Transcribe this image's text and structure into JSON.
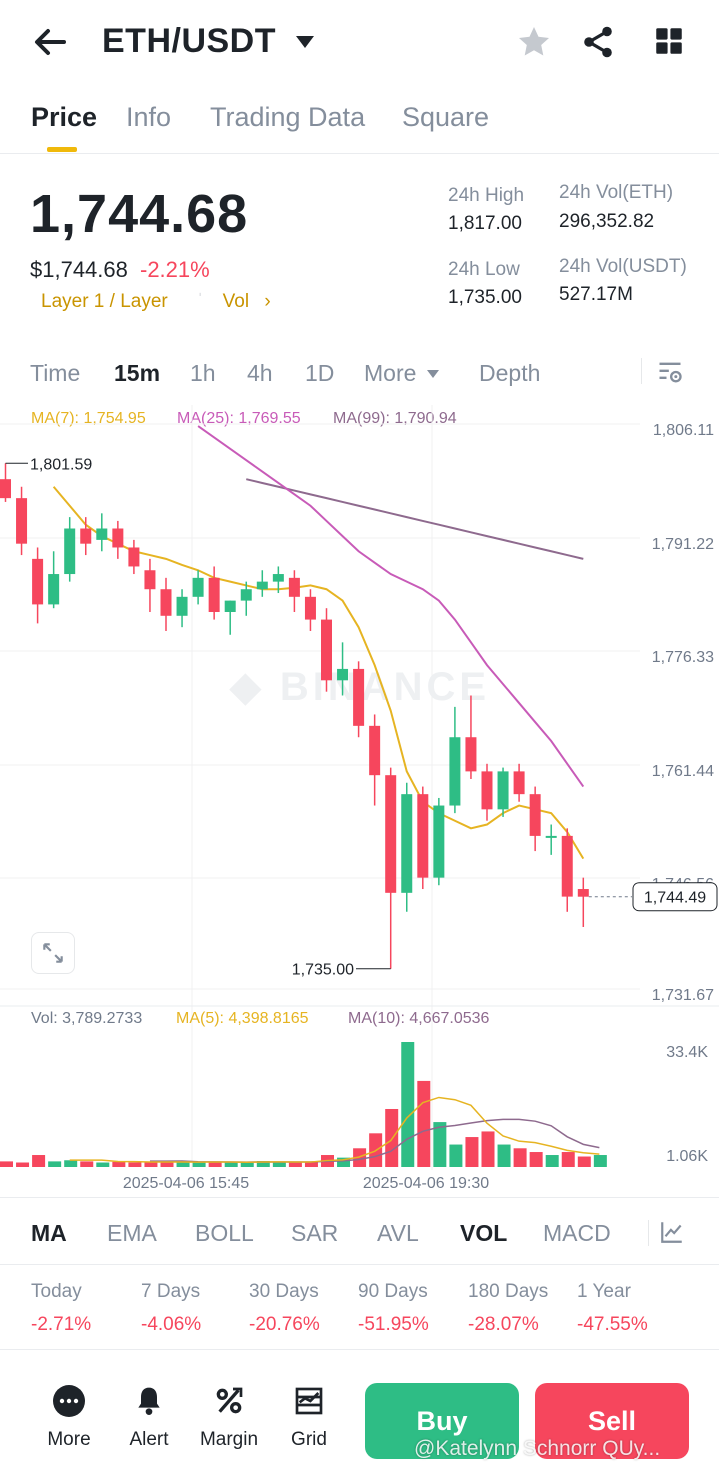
{
  "header": {
    "pair": "ETH/USDT"
  },
  "tabs": [
    "Price",
    "Info",
    "Trading Data",
    "Square"
  ],
  "price": {
    "last": "1,744.68",
    "usd": "$1,744.68",
    "change": "-2.21%",
    "tags": "Layer 1 / Layer",
    "vol_link": "Vol",
    "high_label": "24h High",
    "high": "1,817.00",
    "low_label": "24h Low",
    "low": "1,735.00",
    "vol_eth_label": "24h Vol(ETH)",
    "vol_eth": "296,352.82",
    "vol_usdt_label": "24h Vol(USDT)",
    "vol_usdt": "527.17M"
  },
  "timeframes": [
    "Time",
    "15m",
    "1h",
    "4h",
    "1D",
    "More",
    "Depth"
  ],
  "ma": {
    "ma7": "MA(7): 1,754.95",
    "ma25": "MA(25): 1,769.55",
    "ma99": "MA(99): 1,790.94"
  },
  "colors": {
    "up": "#2ebd85",
    "down": "#f6465d",
    "ma7": "#e6b422",
    "ma25": "#c85bb8",
    "ma99": "#8e6a8e",
    "brand": "#f0b90b"
  },
  "chart_data": {
    "type": "candlestick",
    "watermark": "BINANCE",
    "y_ticks": [
      "1,806.11",
      "1,791.22",
      "1,776.33",
      "1,761.44",
      "1,746.56",
      "1,731.67"
    ],
    "ylim": [
      1731.67,
      1806.11
    ],
    "last_price_label": "1,744.49",
    "high_marker": "1,801.59",
    "low_marker": "1,735.00",
    "x_labels": [
      "2025-04-06 15:45",
      "2025-04-06 19:30"
    ],
    "candles": [
      {
        "o": 1799.5,
        "h": 1801.59,
        "l": 1796.5,
        "c": 1797.0
      },
      {
        "o": 1797.0,
        "h": 1798.5,
        "l": 1789.5,
        "c": 1791.0
      },
      {
        "o": 1789.0,
        "h": 1790.5,
        "l": 1780.5,
        "c": 1783.0
      },
      {
        "o": 1783.0,
        "h": 1790.0,
        "l": 1782.5,
        "c": 1787.0
      },
      {
        "o": 1787.0,
        "h": 1794.5,
        "l": 1786.0,
        "c": 1793.0
      },
      {
        "o": 1793.0,
        "h": 1794.5,
        "l": 1789.5,
        "c": 1791.0
      },
      {
        "o": 1791.5,
        "h": 1795.0,
        "l": 1790.0,
        "c": 1793.0
      },
      {
        "o": 1793.0,
        "h": 1794.0,
        "l": 1789.0,
        "c": 1790.5
      },
      {
        "o": 1790.5,
        "h": 1791.5,
        "l": 1787.0,
        "c": 1788.0
      },
      {
        "o": 1787.5,
        "h": 1789.0,
        "l": 1782.0,
        "c": 1785.0
      },
      {
        "o": 1785.0,
        "h": 1786.5,
        "l": 1779.5,
        "c": 1781.5
      },
      {
        "o": 1781.5,
        "h": 1785.0,
        "l": 1780.0,
        "c": 1784.0
      },
      {
        "o": 1784.0,
        "h": 1787.5,
        "l": 1783.0,
        "c": 1786.5
      },
      {
        "o": 1786.5,
        "h": 1788.0,
        "l": 1781.0,
        "c": 1782.0
      },
      {
        "o": 1782.0,
        "h": 1783.5,
        "l": 1779.0,
        "c": 1783.5
      },
      {
        "o": 1783.5,
        "h": 1786.0,
        "l": 1781.5,
        "c": 1785.0
      },
      {
        "o": 1785.0,
        "h": 1787.5,
        "l": 1784.0,
        "c": 1786.0
      },
      {
        "o": 1786.0,
        "h": 1788.0,
        "l": 1784.5,
        "c": 1787.0
      },
      {
        "o": 1786.5,
        "h": 1787.5,
        "l": 1782.0,
        "c": 1784.0
      },
      {
        "o": 1784.0,
        "h": 1785.0,
        "l": 1779.5,
        "c": 1781.0
      },
      {
        "o": 1781.0,
        "h": 1782.5,
        "l": 1771.5,
        "c": 1773.0
      },
      {
        "o": 1773.0,
        "h": 1778.0,
        "l": 1771.0,
        "c": 1774.5
      },
      {
        "o": 1774.5,
        "h": 1775.5,
        "l": 1765.5,
        "c": 1767.0
      },
      {
        "o": 1767.0,
        "h": 1768.5,
        "l": 1756.5,
        "c": 1760.5
      },
      {
        "o": 1760.5,
        "h": 1761.5,
        "l": 1735.0,
        "c": 1745.0
      },
      {
        "o": 1745.0,
        "h": 1759.5,
        "l": 1742.5,
        "c": 1758.0
      },
      {
        "o": 1758.0,
        "h": 1759.0,
        "l": 1745.5,
        "c": 1747.0
      },
      {
        "o": 1747.0,
        "h": 1757.5,
        "l": 1746.0,
        "c": 1756.5
      },
      {
        "o": 1756.5,
        "h": 1769.5,
        "l": 1755.5,
        "c": 1765.5
      },
      {
        "o": 1765.5,
        "h": 1771.0,
        "l": 1760.0,
        "c": 1761.0
      },
      {
        "o": 1761.0,
        "h": 1762.0,
        "l": 1754.5,
        "c": 1756.0
      },
      {
        "o": 1756.0,
        "h": 1761.5,
        "l": 1755.0,
        "c": 1761.0
      },
      {
        "o": 1761.0,
        "h": 1762.0,
        "l": 1757.0,
        "c": 1758.0
      },
      {
        "o": 1758.0,
        "h": 1759.0,
        "l": 1750.5,
        "c": 1752.5
      },
      {
        "o": 1752.5,
        "h": 1754.0,
        "l": 1750.0,
        "c": 1752.5
      },
      {
        "o": 1752.5,
        "h": 1753.5,
        "l": 1742.5,
        "c": 1744.5
      },
      {
        "o": 1745.5,
        "h": 1747.0,
        "l": 1740.5,
        "c": 1744.49
      }
    ],
    "ma7_series": [
      1798.5,
      1796.0,
      1793.5,
      1792.0,
      1791.0,
      1790.0,
      1789.5,
      1789.0,
      1788.2,
      1787.5,
      1786.5,
      1786.0,
      1785.5,
      1785.0,
      1785.0,
      1785.2,
      1785.5,
      1785.0,
      1783.5,
      1780.0,
      1775.0,
      1769.0,
      1761.0,
      1757.0,
      1755.5,
      1754.5,
      1753.5,
      1754.0,
      1755.5,
      1756.5,
      1756.0,
      1755.5,
      1753.0,
      1749.5
    ],
    "ma25_series": [
      1806.5,
      1805.0,
      1803.5,
      1802.0,
      1800.5,
      1799.0,
      1797.5,
      1796.0,
      1794.0,
      1792.0,
      1790.0,
      1788.5,
      1787.0,
      1786.0,
      1785.0,
      1783.5,
      1781.0,
      1778.0,
      1775.0,
      1772.5,
      1770.0,
      1767.5,
      1765.0,
      1762.0,
      1759.0
    ],
    "ma99_series": [
      1799.5,
      1799.0,
      1798.5,
      1798.0,
      1797.5,
      1797.0,
      1796.5,
      1796.0,
      1795.5,
      1795.0,
      1794.5,
      1794.0,
      1793.5,
      1793.0,
      1792.5,
      1792.0,
      1791.5,
      1791.0,
      1790.5,
      1790.0,
      1789.5,
      1789.0
    ],
    "volume": {
      "label": "Vol: 3,789.2733",
      "ma5_label": "MA(5): 4,398.8165",
      "ma10_label": "MA(10): 4,667.0536",
      "y_ticks": [
        "33.4K",
        "1.06K"
      ],
      "values": [
        1.5,
        1.2,
        3.2,
        1.5,
        1.8,
        1.5,
        1.2,
        1.4,
        1.2,
        1.3,
        1.5,
        1.3,
        1.2,
        1.4,
        1.3,
        1.2,
        1.6,
        1.3,
        1.2,
        1.3,
        3.2,
        2.5,
        5.0,
        9.0,
        15.5,
        33.4,
        23.0,
        12.0,
        6.0,
        8.0,
        9.5,
        6.0,
        5.0,
        4.0,
        3.2,
        4.0,
        2.8,
        3.2
      ]
    }
  },
  "indicators": [
    "MA",
    "EMA",
    "BOLL",
    "SAR",
    "AVL",
    "VOL",
    "MACD"
  ],
  "performance": [
    {
      "label": "Today",
      "value": "-2.71%"
    },
    {
      "label": "7 Days",
      "value": "-4.06%"
    },
    {
      "label": "30 Days",
      "value": "-20.76%"
    },
    {
      "label": "90 Days",
      "value": "-51.95%"
    },
    {
      "label": "180 Days",
      "value": "-28.07%"
    },
    {
      "label": "1 Year",
      "value": "-47.55%"
    }
  ],
  "bottom_nav": [
    "More",
    "Alert",
    "Margin",
    "Grid"
  ],
  "actions": {
    "buy": "Buy",
    "sell": "Sell"
  },
  "watermark_text": "@Katelynn Schnorr QUy..."
}
